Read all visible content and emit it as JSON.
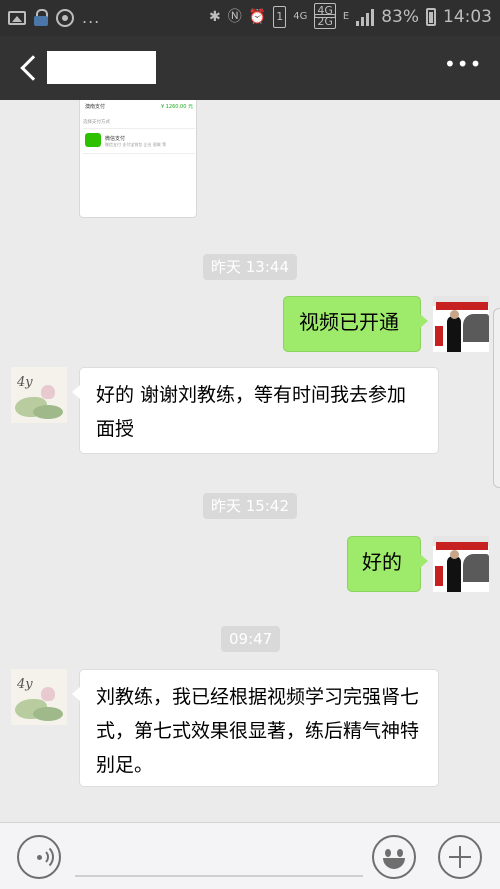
{
  "status_bar": {
    "network_top": "4G",
    "network_box_1": "4G",
    "network_box_2": "2G",
    "data_indicator": "E",
    "battery": "83%",
    "time": "14:03",
    "sim": "1",
    "more": "..."
  },
  "header": {
    "back_icon": "chevron-left-icon",
    "contact_name": "",
    "more_icon": "more-dots-icon",
    "more_label": "•••"
  },
  "card": {
    "title": "澳南支付",
    "amount": "¥ 1260.00 元",
    "section_label": "选择支付方式",
    "method_name": "微信支付",
    "method_desc": "微信支付 支付宝钱包 企业 银联 等"
  },
  "messages": [
    {
      "type": "time",
      "text": "昨天 13:44"
    },
    {
      "type": "outgoing",
      "sender": "coach",
      "text": "视频已开通"
    },
    {
      "type": "incoming",
      "sender": "student",
      "text": "好的 谢谢刘教练，等有时间我去参加面授"
    },
    {
      "type": "time",
      "text": "昨天 15:42"
    },
    {
      "type": "outgoing",
      "sender": "coach",
      "text": "好的"
    },
    {
      "type": "time",
      "text": "09:47"
    },
    {
      "type": "incoming",
      "sender": "student",
      "text": "刘教练，我已经根据视频学习完强肾七式，第七式效果很显著，练后精气神特别足。"
    }
  ],
  "input_bar": {
    "voice_icon": "voice-icon",
    "emoji_icon": "emoji-icon",
    "plus_icon": "plus-icon"
  },
  "colors": {
    "outgoing_bubble": "#9eea6a",
    "incoming_bubble": "#ffffff",
    "title_bar": "#333333",
    "chat_bg": "#ebebeb"
  }
}
